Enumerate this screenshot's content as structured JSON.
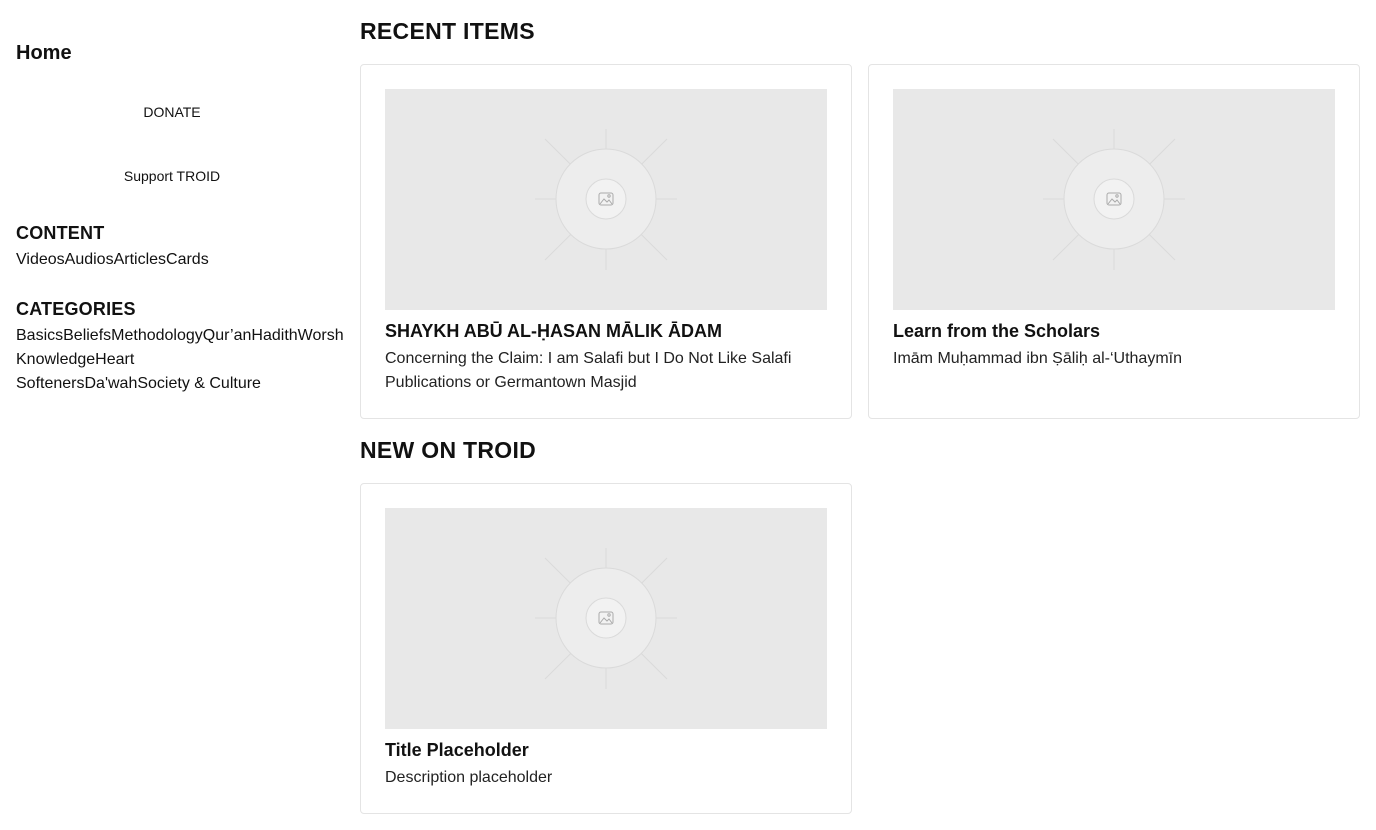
{
  "sidebar": {
    "home": "Home",
    "donate": "DONATE",
    "support": "Support TROID",
    "content_title": "CONTENT",
    "content_links": [
      "Videos",
      "Audios",
      "Articles",
      "Cards"
    ],
    "categories_title": "CATEGORIES",
    "categories": [
      "Basics",
      "Beliefs",
      "Methodology",
      "Qur’an",
      "Hadith",
      "Worsh",
      "Knowledge",
      "Heart",
      "Softeners",
      "Da'wah",
      "Society & Culture"
    ]
  },
  "main": {
    "recent_heading": "RECENT ITEMS",
    "new_heading": "NEW ON TROID",
    "recent_items": [
      {
        "title": "SHAYKH ABŪ AL-ḤASAN MĀLIK ĀDAM",
        "description": "Concerning the Claim: I am Salafi but I Do Not Like Salafi Publications or Germantown Masjid"
      },
      {
        "title": "Learn from the Scholars",
        "description": "Imām Muḥammad ibn Ṣāliḥ al-‘Uthaymīn"
      }
    ],
    "new_items": [
      {
        "title": "Title Placeholder",
        "description": "Description placeholder"
      }
    ]
  },
  "icons": {
    "thumbnail": "image-placeholder-icon"
  },
  "colors": {
    "text": "#111111",
    "thumbnail_bg": "#e8e8e8",
    "card_border": "#e4e4e4"
  }
}
